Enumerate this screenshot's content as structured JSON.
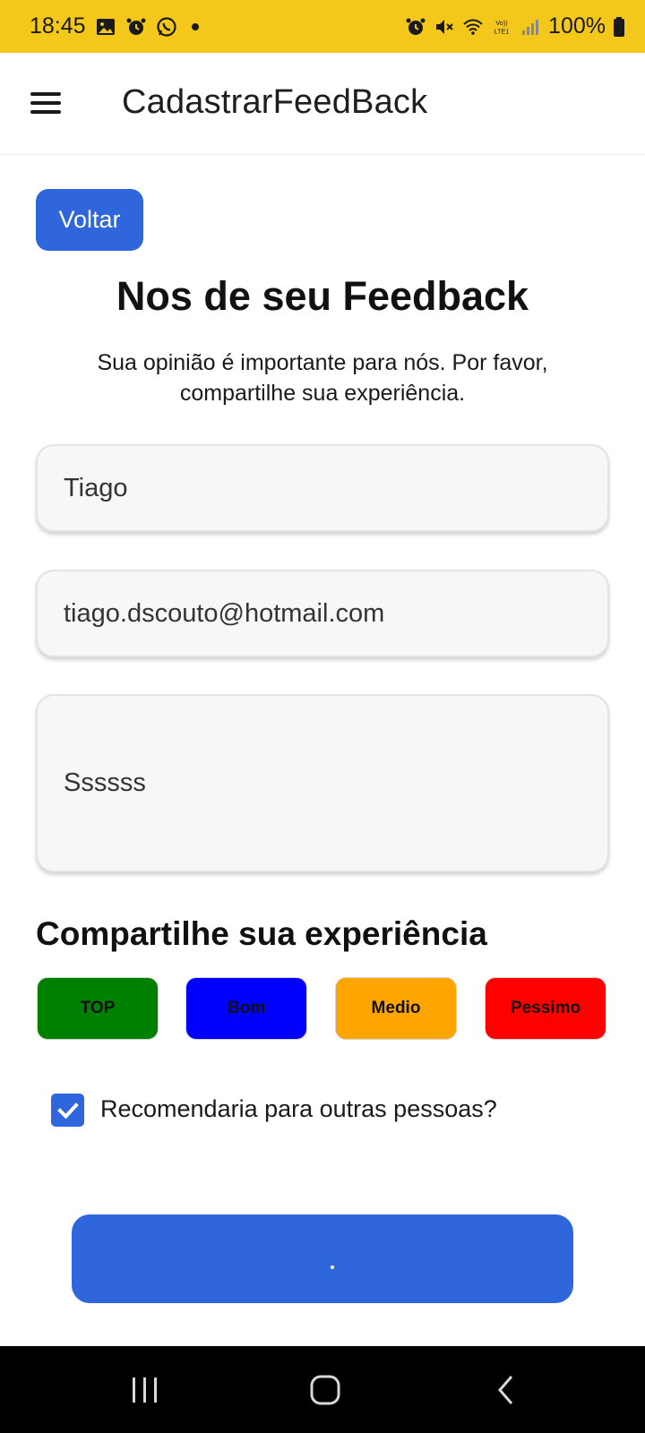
{
  "status_bar": {
    "time": "18:45",
    "battery": "100%",
    "left_icons": [
      "image-icon",
      "alarm-icon",
      "whatsapp-icon",
      "dot-icon"
    ],
    "right_icons": [
      "alarm-icon",
      "mute-icon",
      "wifi-icon",
      "volte-icon",
      "signal-icon",
      "battery-icon"
    ],
    "network": "Vo)) LTE1"
  },
  "app_bar": {
    "title": "CadastrarFeedBack",
    "menu_icon": "hamburger-menu-icon"
  },
  "back_button": {
    "label": "Voltar"
  },
  "heading": "Nos de seu Feedback",
  "subtitle": "Sua opinião é importante para nós. Por favor, compartilhe sua experiência.",
  "form": {
    "name_value": "Tiago",
    "email_value": "tiago.dscouto@hotmail.com",
    "comment_value": "Ssssss"
  },
  "experience": {
    "title": "Compartilhe sua experiência",
    "options": [
      {
        "label": "TOP",
        "color": "#008000"
      },
      {
        "label": "Bom",
        "color": "#0000ff"
      },
      {
        "label": "Medio",
        "color": "#ffa500"
      },
      {
        "label": "Pessimo",
        "color": "#ff0000"
      }
    ]
  },
  "recommend": {
    "label": "Recomendaria para outras pessoas?",
    "checked": true
  },
  "submit_button": {
    "label": ""
  },
  "nav_bar": {
    "items": [
      "recent-apps-icon",
      "home-icon",
      "back-icon"
    ]
  },
  "colors": {
    "status_bar": "#f4c81a",
    "accent": "#2f66dc",
    "nav_bar": "#000000"
  }
}
